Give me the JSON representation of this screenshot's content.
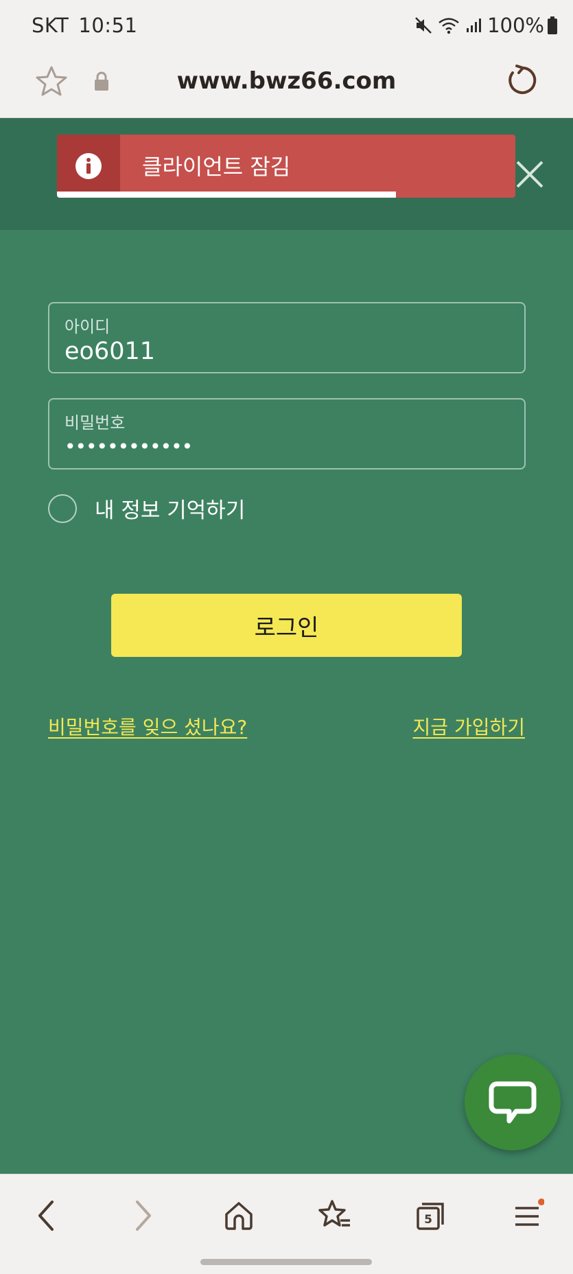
{
  "status_bar": {
    "carrier": "SKT",
    "time": "10:51",
    "battery": "100%"
  },
  "browser": {
    "url": "www.bwz66.com",
    "tab_count": "5"
  },
  "toast": {
    "message": "클라이언트 잠김",
    "progress": 0.74,
    "color": "#c5504c"
  },
  "login_form": {
    "id_label": "아이디",
    "id_value": "eo6011",
    "password_label": "비밀번호",
    "password_value": "••••••••••••",
    "remember_label": "내 정보 기억하기",
    "login_button": "로그인",
    "forgot_link": "비밀번호를 잊으 셨나요?",
    "signup_link": "지금 가입하기"
  },
  "colors": {
    "background": "#3d8161",
    "accent": "#f5e854",
    "chat_button": "#3a8a3a",
    "notification_dot": "#e0612a"
  },
  "icons": {
    "bookmark": "star-icon",
    "lock": "lock-icon",
    "reload": "reload-icon",
    "toast": "info-icon",
    "close": "close-icon",
    "chat": "chat-bubble-icon",
    "back": "back-icon",
    "forward": "forward-icon",
    "home": "home-icon",
    "favorites": "bookmarks-icon",
    "tabs": "tabs-icon",
    "menu": "menu-icon"
  }
}
